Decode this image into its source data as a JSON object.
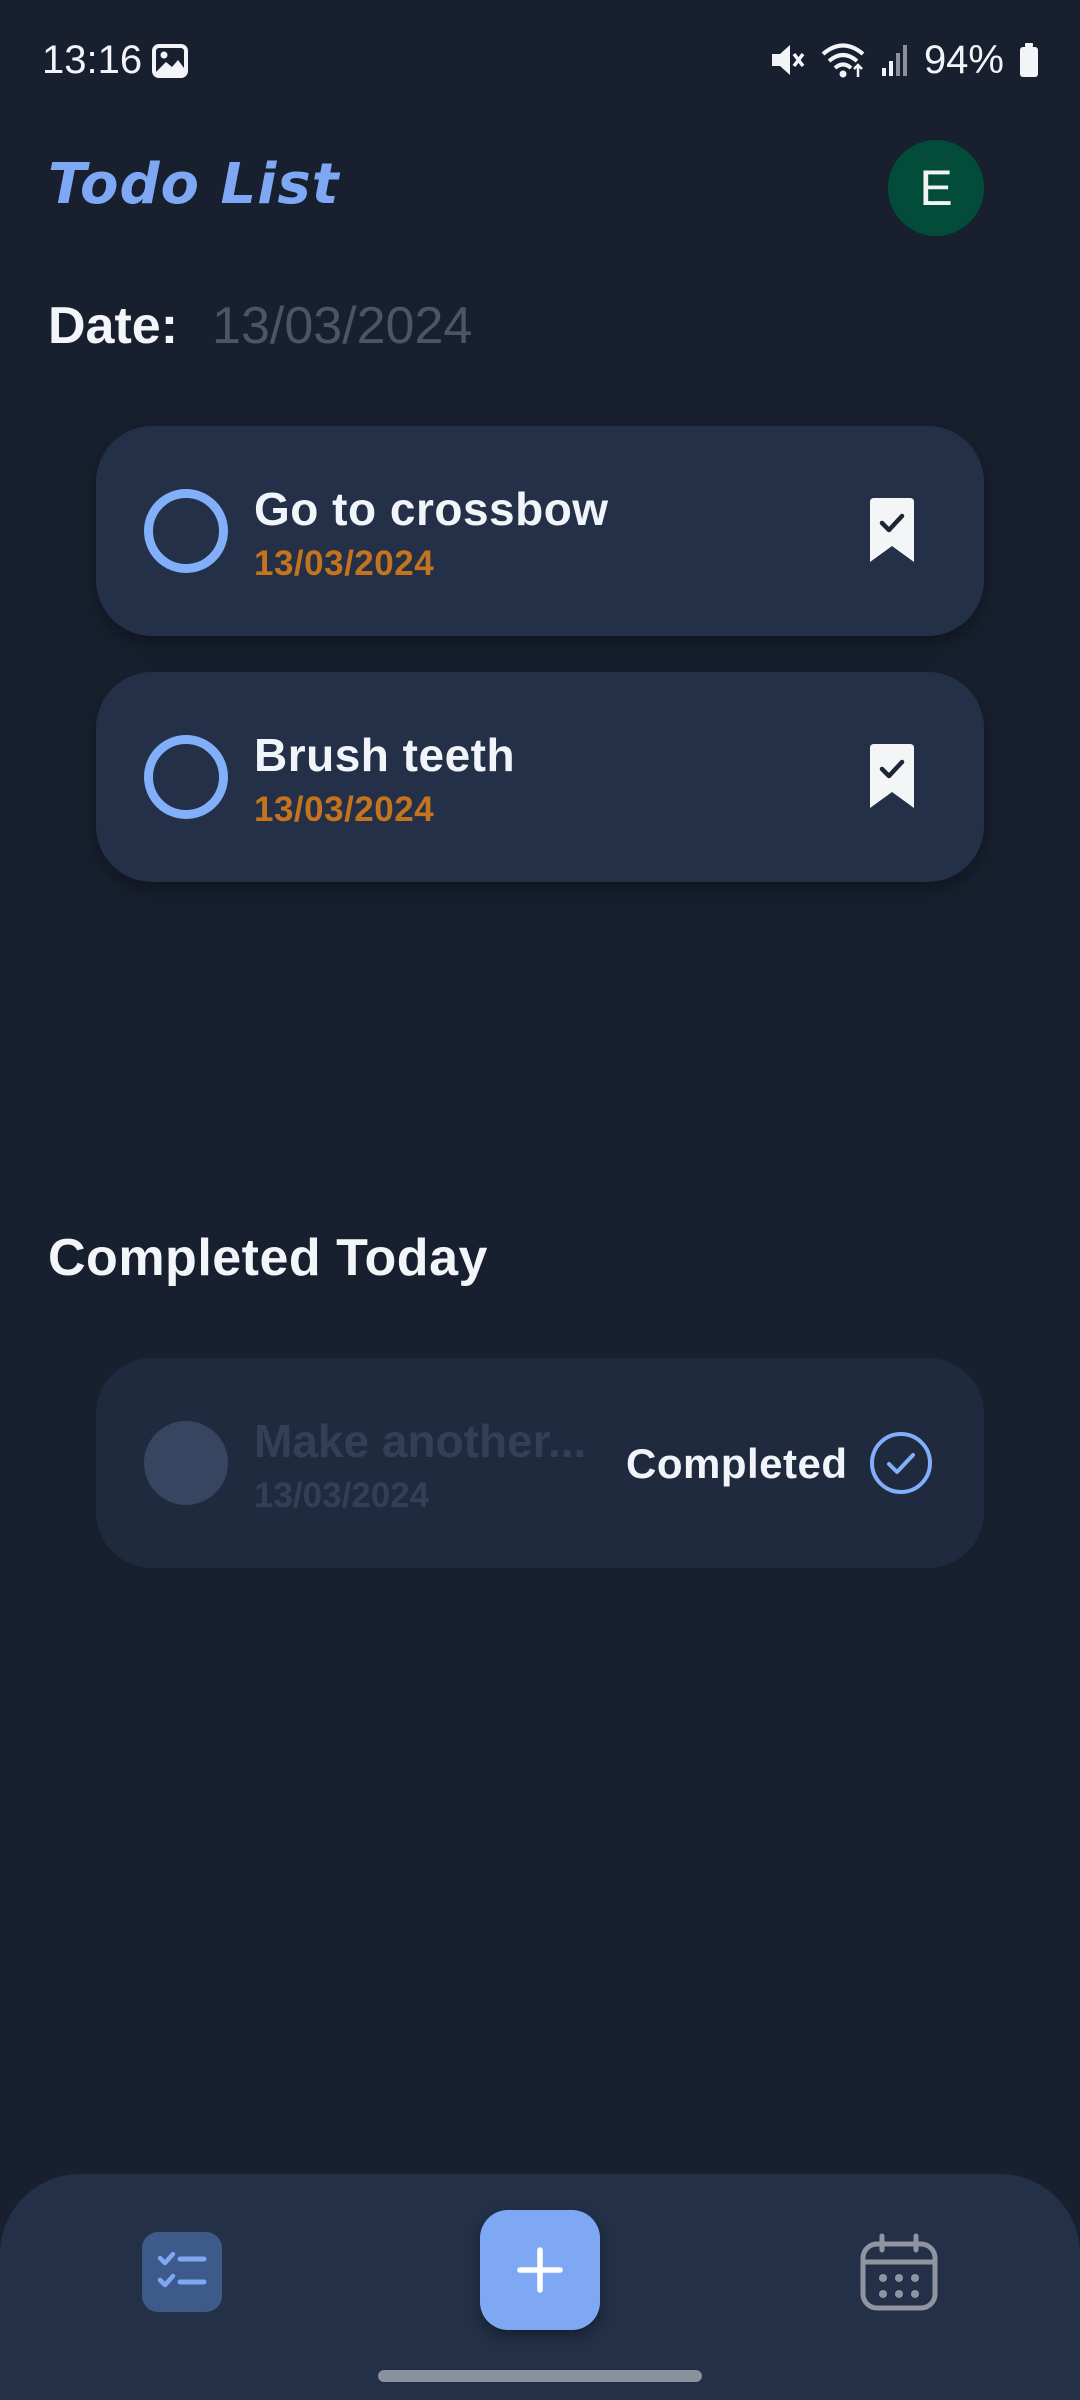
{
  "status_bar": {
    "time": "13:16",
    "battery": "94%",
    "icons": [
      "gallery-icon",
      "mute-icon",
      "wifi-icon",
      "signal-icon",
      "battery-icon"
    ]
  },
  "header": {
    "title": "Todo List",
    "avatar_initial": "E",
    "date_label": "Date:",
    "date_value": "13/03/2024"
  },
  "todos": [
    {
      "title": "Go to crossbow",
      "date": "13/03/2024",
      "icon": "bookmark-check-icon"
    },
    {
      "title": "Brush teeth",
      "date": "13/03/2024",
      "icon": "bookmark-check-icon"
    }
  ],
  "completed_section": {
    "title": "Completed Today",
    "items": [
      {
        "title": "Make another...",
        "date": "13/03/2024",
        "status": "Completed",
        "icon": "check-circle-icon"
      }
    ]
  },
  "bottom_nav": {
    "items": [
      "tasks-icon",
      "add-icon",
      "calendar-icon"
    ]
  },
  "colors": {
    "background": "#18202f",
    "card": "#233048",
    "accent": "#7fa8f4",
    "date_accent": "#c5741e",
    "avatar": "#044c3a"
  }
}
